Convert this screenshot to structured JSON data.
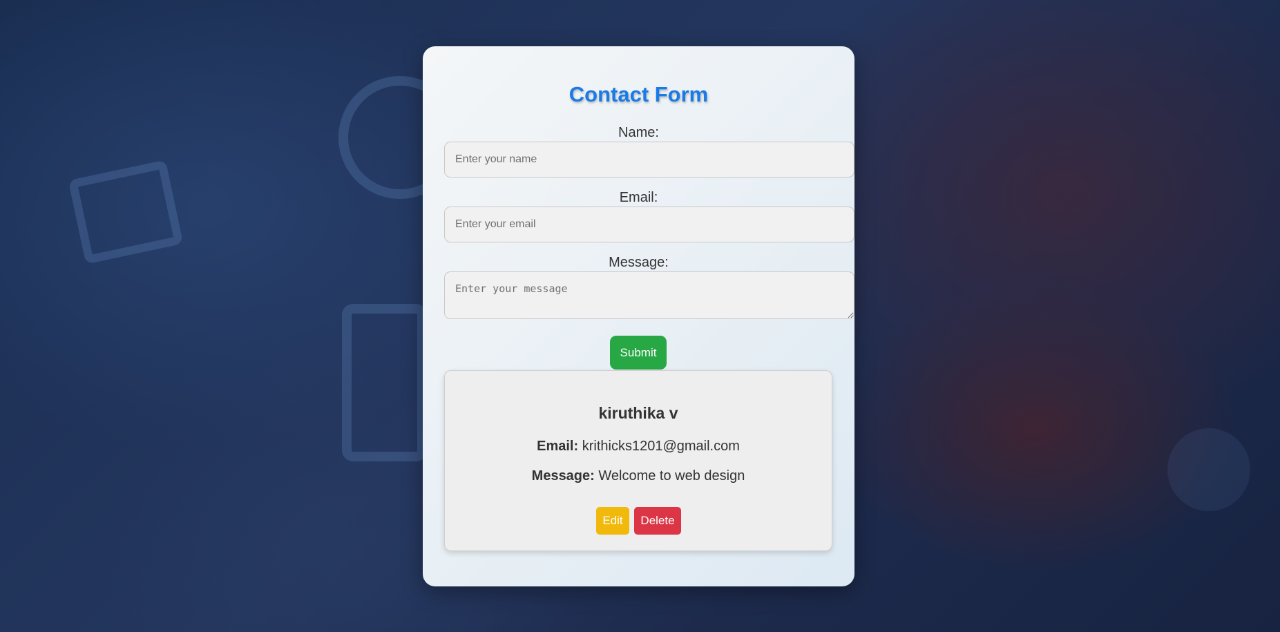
{
  "form": {
    "title": "Contact Form",
    "name_label": "Name:",
    "name_placeholder": "Enter your name",
    "email_label": "Email:",
    "email_placeholder": "Enter your email",
    "message_label": "Message:",
    "message_placeholder": "Enter your message",
    "submit_label": "Submit"
  },
  "entry": {
    "name": "kiruthika v",
    "email_label": "Email:",
    "email": "krithicks1201@gmail.com",
    "message_label": "Message:",
    "message": "Welcome to web design",
    "edit_label": "Edit",
    "delete_label": "Delete"
  },
  "colors": {
    "title": "#1a7ae6",
    "submit": "#28a745",
    "edit": "#f0b90b",
    "delete": "#dc3545"
  }
}
